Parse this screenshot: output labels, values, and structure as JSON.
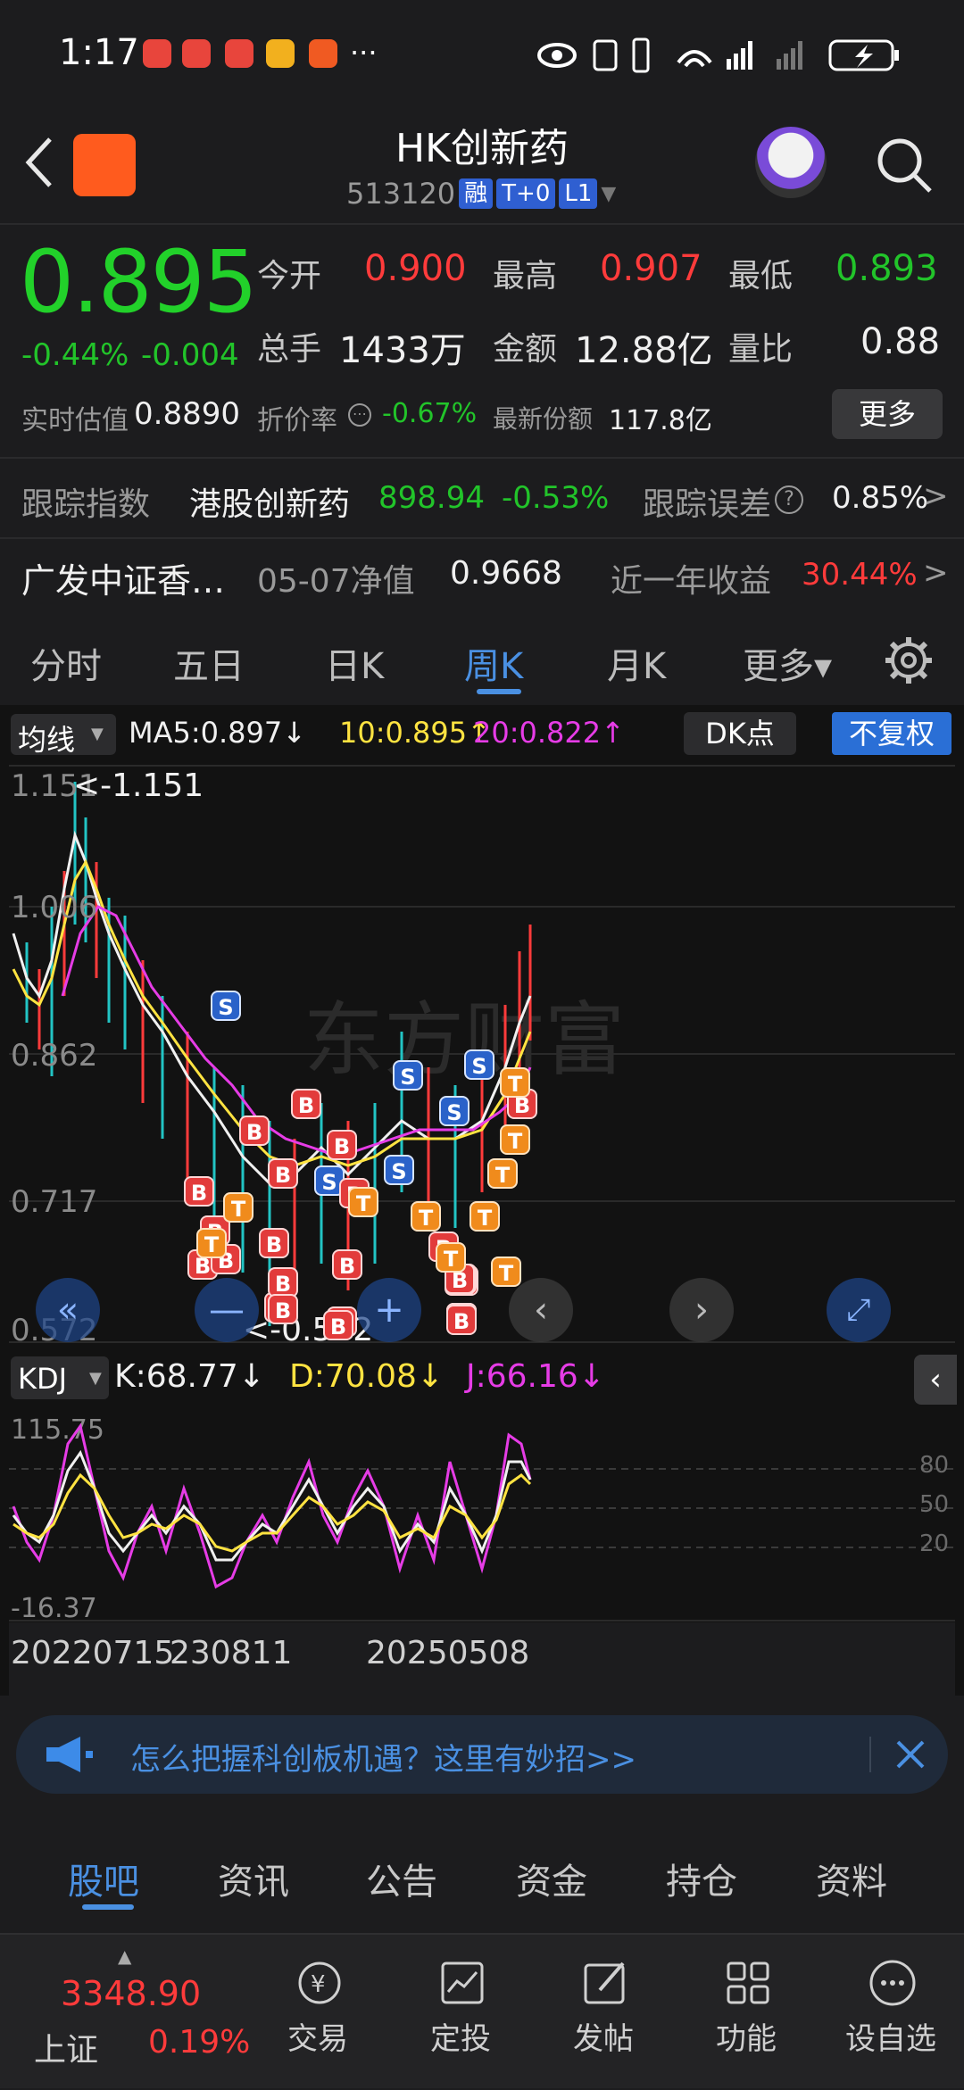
{
  "status": {
    "time": "1:17",
    "more": "···"
  },
  "header": {
    "title": "HK创新药",
    "code": "513120",
    "tags": [
      "融",
      "T+0",
      "L1"
    ]
  },
  "quote": {
    "price": "0.895",
    "change_pct": "-0.44%",
    "change": "-0.004",
    "open_label": "今开",
    "open": "0.900",
    "high_label": "最高",
    "high": "0.907",
    "low_label": "最低",
    "low": "0.893",
    "volume_label": "总手",
    "volume": "1433万",
    "amount_label": "金额",
    "amount": "12.88亿",
    "ratio_label": "量比",
    "ratio": "0.88",
    "iopv_label": "实时估值",
    "iopv": "0.8890",
    "premium_label": "折价率",
    "premium": "-0.67%",
    "shares_label": "最新份额",
    "shares": "117.8亿",
    "more_label": "更多"
  },
  "tracking": {
    "label": "跟踪指数",
    "index": "港股创新药",
    "value": "898.94",
    "pct": "-0.53%",
    "error_label": "跟踪误差",
    "error": "0.85%",
    "arrow": ">"
  },
  "fund": {
    "name": "广发中证香…",
    "nav_label": "05-07净值",
    "nav": "0.9668",
    "yr_label": "近一年收益",
    "yr": "30.44%",
    "arrow": ">"
  },
  "kline_tabs": [
    "分时",
    "五日",
    "日K",
    "周K",
    "月K",
    "更多▾"
  ],
  "ma": {
    "selector": "均线",
    "ma5": "MA5:0.897↓",
    "ma10": "10:0.895↑",
    "ma20": "20:0.822↑",
    "dk": "DK点",
    "adjust": "不复权"
  },
  "chart": {
    "y_labels": [
      "1.151",
      "1.006",
      "0.862",
      "0.717",
      "0.572"
    ],
    "max_note": "<-1.151",
    "min_note": "<-0.572"
  },
  "kdj": {
    "selector": "KDJ",
    "k": "K:68.77↓",
    "d": "D:70.08↓",
    "j": "J:66.16↓",
    "y_top": "115.75",
    "y_bottom": "-16.37",
    "levels": [
      "80",
      "50",
      "20"
    ],
    "x_labels": [
      "20220715",
      "230811",
      "20250508"
    ]
  },
  "banner": {
    "text": "怎么把握科创板机遇？这里有妙招>>"
  },
  "bottom_tabs": [
    "股吧",
    "资讯",
    "公告",
    "资金",
    "持仓",
    "资料"
  ],
  "nav": {
    "index_value": "3348.90",
    "index_name": "上证",
    "index_pct": "0.19%",
    "items": [
      "交易",
      "定投",
      "发帖",
      "功能",
      "设自选"
    ]
  },
  "colors": {
    "up": "#ff3b3b",
    "down": "#22c42a",
    "accent": "#4a90e2",
    "bg": "#1c1c1e"
  }
}
